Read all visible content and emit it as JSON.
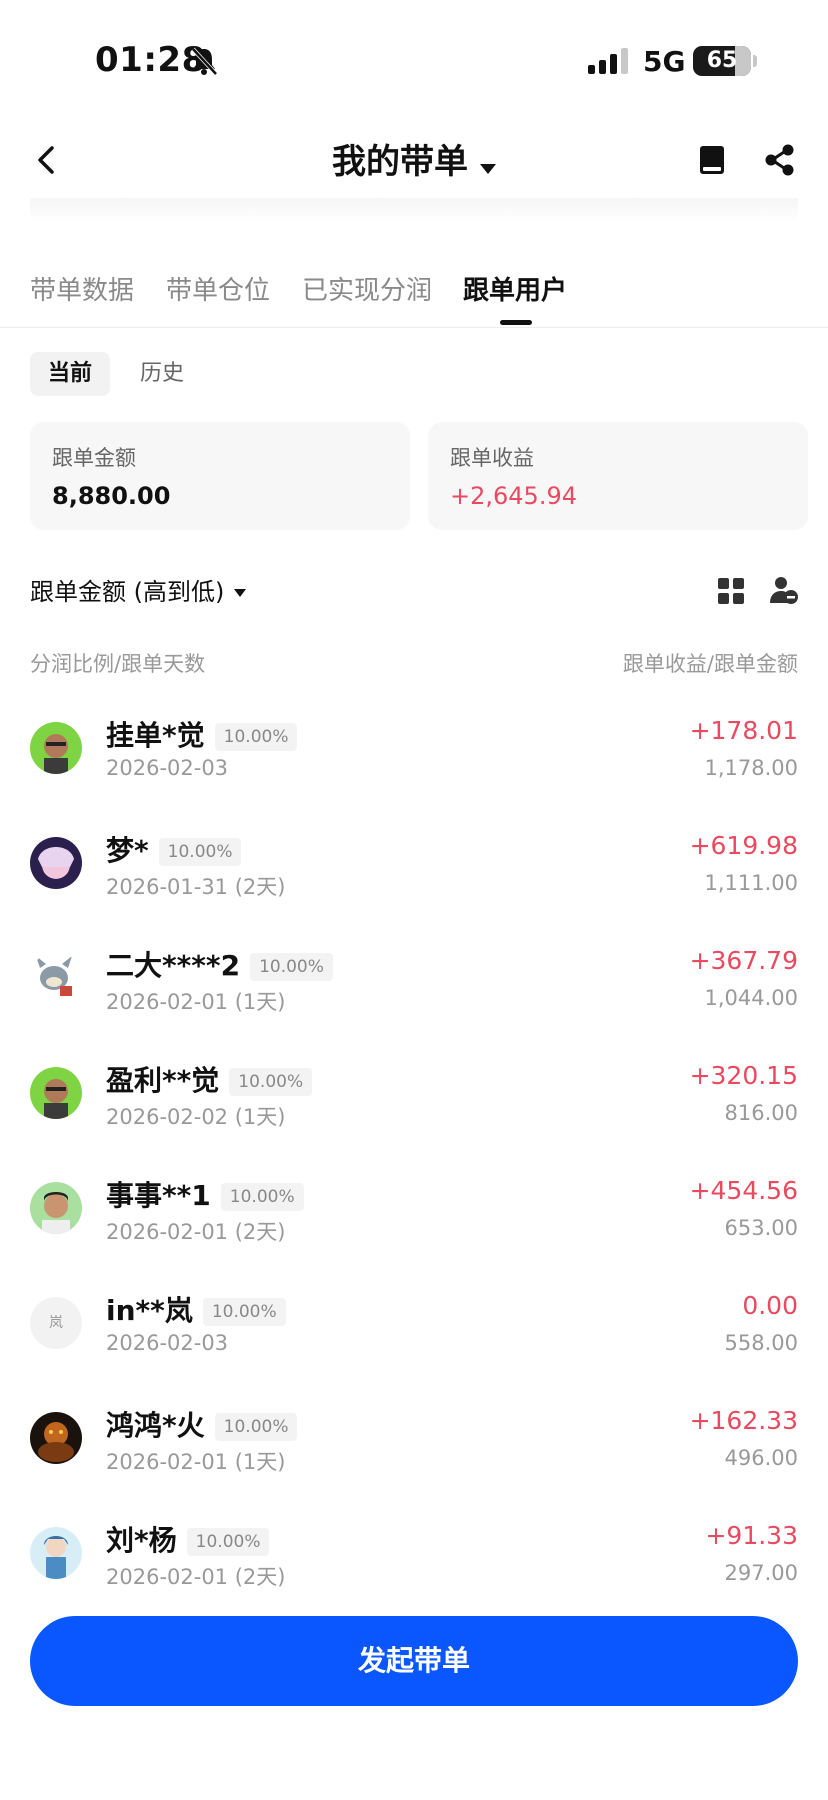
{
  "status_bar": {
    "time": "01:28",
    "network": "5G",
    "battery": "65"
  },
  "header": {
    "title": "我的带单"
  },
  "tabs": [
    {
      "label": "带单数据"
    },
    {
      "label": "带单仓位"
    },
    {
      "label": "已实现分润"
    },
    {
      "label": "跟单用户"
    }
  ],
  "segments": {
    "current": "当前",
    "history": "历史"
  },
  "summary": {
    "amount_label": "跟单金额",
    "amount_value": "8,880.00",
    "profit_label": "跟单收益",
    "profit_value": "+2,645.94"
  },
  "sort": {
    "label": "跟单金额 (高到低)"
  },
  "columns": {
    "left": "分润比例/跟单天数",
    "right": "跟单收益/跟单金额"
  },
  "users": [
    {
      "name": "挂单*觉",
      "ratio": "10.00%",
      "date": "2026-02-03",
      "profit": "+178.01",
      "amount": "1,178.00"
    },
    {
      "name": "梦*",
      "ratio": "10.00%",
      "date": "2026-01-31 (2天)",
      "profit": "+619.98",
      "amount": "1,111.00"
    },
    {
      "name": "二大****2",
      "ratio": "10.00%",
      "date": "2026-02-01 (1天)",
      "profit": "+367.79",
      "amount": "1,044.00"
    },
    {
      "name": "盈利**觉",
      "ratio": "10.00%",
      "date": "2026-02-02 (1天)",
      "profit": "+320.15",
      "amount": "816.00"
    },
    {
      "name": "事事**1",
      "ratio": "10.00%",
      "date": "2026-02-01 (2天)",
      "profit": "+454.56",
      "amount": "653.00"
    },
    {
      "name": "in**岚",
      "ratio": "10.00%",
      "date": "2026-02-03",
      "profit": "0.00",
      "amount": "558.00",
      "avatar_text": "岚"
    },
    {
      "name": "鸿鸿*火",
      "ratio": "10.00%",
      "date": "2026-02-01 (1天)",
      "profit": "+162.33",
      "amount": "496.00"
    },
    {
      "name": "刘*杨",
      "ratio": "10.00%",
      "date": "2026-02-01 (2天)",
      "profit": "+91.33",
      "amount": "297.00"
    }
  ],
  "cta": {
    "label": "发起带单"
  },
  "colors": {
    "accent": "#0b57ff",
    "profit": "#e84a5f",
    "muted": "#999999"
  }
}
